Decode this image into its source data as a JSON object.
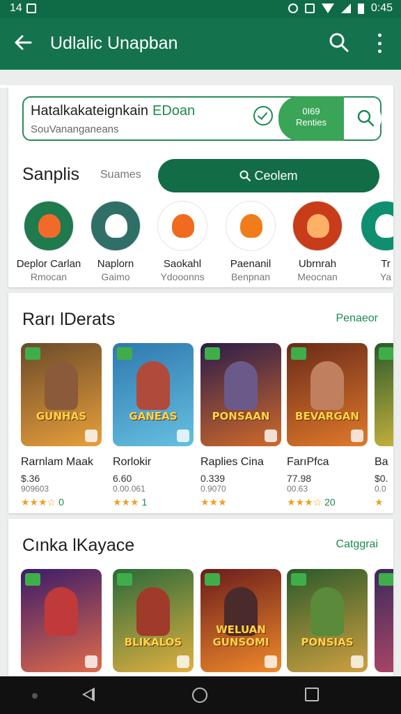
{
  "status_bar": {
    "left_text": "14",
    "time": "0:45"
  },
  "app_bar": {
    "title": "Udlalic Unapban",
    "icons": [
      "back-arrow-icon",
      "search-icon",
      "more-vert-icon"
    ]
  },
  "search": {
    "text": "Hatalkakateignkain",
    "tag": "EDoan",
    "subtext": "SouVananganeans",
    "pill_line1": "0I69",
    "pill_line2": "Renties"
  },
  "filters": {
    "heading": "Sanplis",
    "subtitle": "Suames",
    "button_label": "Ceolem"
  },
  "categories": [
    {
      "label": "Deplor Carlan",
      "sublabel": "Rmocan",
      "color": "#1f7a4d",
      "accent": "#f26a2a"
    },
    {
      "label": "Naplorn",
      "sublabel": "Gaimo",
      "color": "#2f6f67",
      "accent": "#ffffff"
    },
    {
      "label": "Saokahl",
      "sublabel": "Ydooonns",
      "color": "#ffffff",
      "accent": "#f06a1f"
    },
    {
      "label": "Paenanil",
      "sublabel": "Benpnan",
      "color": "#ffffff",
      "accent": "#f07d1a"
    },
    {
      "label": "Ubrnrah",
      "sublabel": "Meocnan",
      "color": "#c93c1a",
      "accent": "#ffb067"
    },
    {
      "label": "Tr",
      "sublabel": "Ya",
      "color": "#0f8f70",
      "accent": "#ffffff"
    }
  ],
  "section1": {
    "title": "Rarı lDerats",
    "link": "Penaeor",
    "games": [
      {
        "name": "Rarnlam Maak",
        "price": "$.36",
        "size": "909603",
        "stars": "★★★☆",
        "count": "0",
        "logo": "GUNHAS",
        "bg1": "#6b4a2a",
        "bg2": "#e8a03a",
        "hero": "#8a5a3a"
      },
      {
        "name": "Rorlokir",
        "price": "6.60",
        "size": "0.00.061",
        "stars": "★★★",
        "count": "1",
        "logo": "GANEAS",
        "bg1": "#2f78b0",
        "bg2": "#66c0e0",
        "hero": "#b04a3a"
      },
      {
        "name": "Raplies Cina",
        "price": "0.339",
        "size": "0.9070",
        "stars": "★★★",
        "count": "",
        "logo": "PONSAAN",
        "bg1": "#2a1c4a",
        "bg2": "#d06a2a",
        "hero": "#6a5a8a"
      },
      {
        "name": "FarıPfca",
        "price": "77.98",
        "size": "00.63",
        "stars": "★★★☆",
        "count": "20",
        "logo": "BEVARGAN",
        "bg1": "#6a2a1a",
        "bg2": "#e07a2a",
        "hero": "#c08060"
      },
      {
        "name": "Ba",
        "price": "$0.",
        "size": "0.0",
        "stars": "★",
        "count": "",
        "logo": "",
        "bg1": "#2a5a2a",
        "bg2": "#e0c040",
        "hero": "#4a8a3a"
      }
    ]
  },
  "section2": {
    "title": "Cınka lKayace",
    "link": "Catggrai",
    "games": [
      {
        "logo": "",
        "bg1": "#3a1c6a",
        "bg2": "#e06a4a",
        "hero": "#c03a3a"
      },
      {
        "logo": "BLIKALOS",
        "bg1": "#2a6a3a",
        "bg2": "#e0b040",
        "hero": "#a03a2a"
      },
      {
        "logo": "WELUAN GUNSOMI",
        "bg1": "#6a1c1c",
        "bg2": "#f08a2a",
        "hero": "#4a2a2a"
      },
      {
        "logo": "PONSIAS",
        "bg1": "#2a5a2a",
        "bg2": "#d0a040",
        "hero": "#5a8a3a"
      },
      {
        "logo": "",
        "bg1": "#3a2a5a",
        "bg2": "#c04a6a",
        "hero": "#6a4a8a"
      }
    ]
  }
}
